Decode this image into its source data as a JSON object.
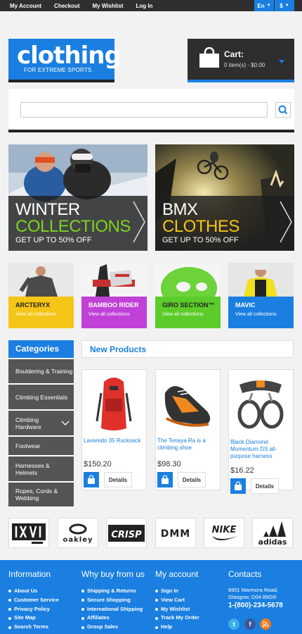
{
  "topbar": {
    "links": [
      "My Account",
      "Checkout",
      "My Wishlist",
      "Log In"
    ],
    "language": "En",
    "currency": "$"
  },
  "logo": {
    "title": "clothing",
    "tagline": "FOR EXTREME SPORTS"
  },
  "cart": {
    "title": "Cart:",
    "summary": "0 item(s) - $0.00"
  },
  "search": {
    "placeholder": ""
  },
  "banners": [
    {
      "line1": "WINTER",
      "line2": "COLLECTIONS",
      "line3": "GET UP TO 50% OFF",
      "accent": "#7ed321"
    },
    {
      "line1": "BMX",
      "line2": "CLOTHES",
      "line3": "GET UP TO 50% OFF",
      "accent": "#f5c518"
    }
  ],
  "brand_tiles": [
    {
      "name": "ARCTERYX",
      "link": "View all collections",
      "color": "#f5c518"
    },
    {
      "name": "BAMBOO RIDER",
      "link": "View all collections",
      "color": "#c040d8"
    },
    {
      "name": "GIRO SECTION™",
      "link": "View all collections",
      "color": "#5ccc2a"
    },
    {
      "name": "MAVIC",
      "link": "View all collections",
      "color": "#1a7fe0"
    }
  ],
  "categories": {
    "title": "Categories",
    "items": [
      "Bouldering & Training",
      "Climbing Essentials",
      "Climbing Hardware",
      "Footwear",
      "Harnesses & Helmets",
      "Ropes, Cords & Webbing"
    ]
  },
  "new_products": {
    "title": "New Products",
    "items": [
      {
        "name": "Lavaredo 35 Rucksack",
        "price": "$150.20",
        "details": "Details"
      },
      {
        "name": "The Tenaya Ra is a climbing shoe",
        "price": "$98.30",
        "details": "Details"
      },
      {
        "name": "Black Diamond Momentum DS all-purpose harness",
        "price": "$16.22",
        "details": "Details"
      }
    ]
  },
  "brands": [
    "LXVI VANS",
    "oakley",
    "CRISP",
    "DMM",
    "NIKE",
    "adidas"
  ],
  "footer": {
    "information": {
      "title": "Information",
      "links": [
        "About Us",
        "Customer Service",
        "Privacy Policy",
        "Site Map",
        "Search Terms"
      ]
    },
    "why": {
      "title": "Why buy from us",
      "links": [
        "Shipping & Returns",
        "Secure Shopping",
        "International Shipping",
        "Affiliates",
        "Group Sales"
      ]
    },
    "account": {
      "title": "My account",
      "links": [
        "Sign In",
        "View Cart",
        "My Wishlist",
        "Track My Order",
        "Help"
      ]
    },
    "contacts": {
      "title": "Contacts",
      "address1": "8901 Marmora Road,",
      "address2": "Glasgow, D04 89GR",
      "phone": "1-(800)-234-5678"
    }
  },
  "colors": {
    "accent": "#1a7fe0",
    "dark": "#2e2e2e",
    "category_bg": "#555555"
  }
}
